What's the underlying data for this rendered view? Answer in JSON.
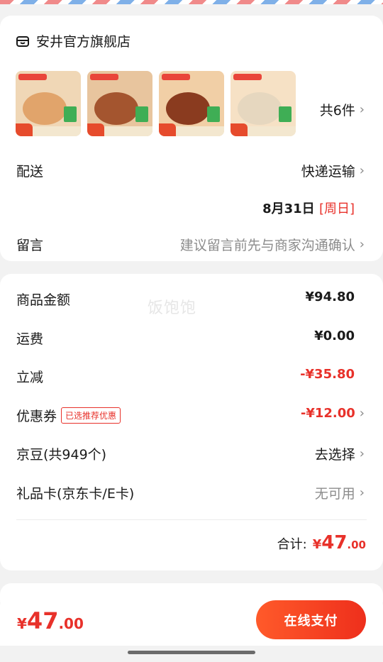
{
  "store": {
    "name": "安井官方旗舰店",
    "icon": "store-icon",
    "item_count": "共6件",
    "products": [
      {
        "bg": "#f0d7b6",
        "food": "#e1a46b"
      },
      {
        "bg": "#e8c59e",
        "food": "#a4552f"
      },
      {
        "bg": "#f1cfa6",
        "food": "#8a3b1f"
      },
      {
        "bg": "#f6e1c5",
        "food": "#e6d7bf"
      }
    ]
  },
  "delivery": {
    "label": "配送",
    "method": "快递运输",
    "date": "8月31日",
    "weekday": "[周日]"
  },
  "message": {
    "label": "留言",
    "placeholder": "建议留言前先与商家沟通确认"
  },
  "watermark": "饭饱饱",
  "amounts": {
    "goods_label": "商品金额",
    "goods_value": "¥94.80",
    "shipping_label": "运费",
    "shipping_value": "¥0.00",
    "discount_label": "立减",
    "discount_value": "-¥35.80",
    "coupon_label": "优惠券",
    "coupon_tag": "已选推荐优惠",
    "coupon_value": "-¥12.00",
    "beans_label": "京豆(共949个)",
    "beans_action": "去选择",
    "giftcard_label": "礼品卡(京东卡/E卡)",
    "giftcard_status": "无可用",
    "total_label": "合计:",
    "total_currency": "¥",
    "total_int": "47",
    "total_dec": ".00"
  },
  "bottom": {
    "currency": "¥",
    "int": "47",
    "dec": ".00",
    "pay_label": "在线支付"
  },
  "colors": {
    "accent": "#e8312a",
    "pay_gradient_start": "#ff5a2a",
    "pay_gradient_end": "#ee2f1c"
  }
}
